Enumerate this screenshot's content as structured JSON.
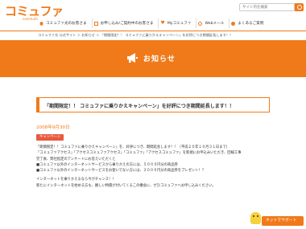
{
  "header": {
    "logo": "コミュファ",
    "logo_sub": "commufa",
    "search_placeholder": "サイト内を検索"
  },
  "nav": [
    {
      "label": "コミュファ光のお客さま",
      "icon": "home-icon"
    },
    {
      "label": "お申し込み/ご契約中のお客さま",
      "icon": "document-icon"
    },
    {
      "label": "Myコミュファ",
      "icon": "heart-icon"
    },
    {
      "label": "Webメール",
      "icon": "globe-icon"
    },
    {
      "label": "よくあるご質問",
      "icon": "question-icon"
    }
  ],
  "breadcrumb": "コミュファ光 公式サイト ＞ お知らせ ＞ 「期間限定！！ コミュファに乗りかえキャンペーン」を好評につき期間延長します！！",
  "banner": {
    "title": "お知らせ",
    "icon": "megaphone-icon",
    "color": "#f07a1a"
  },
  "notice": {
    "title": "「期間限定！！ コミュファに乗りかえキャンペーン」を好評につき期間延長します！！",
    "date": "2008年9月30日",
    "tag": "キャンペーン",
    "paragraphs": [
      "「期間限定！！コミュファに乗りかえキャンペーン」を、好評につき、期間延長します！！（平成２０年１０月３１日まで）",
      "「コミュファアクセス」「アクセスコミュファアクセス」「コミュファ」「アクセスコミュファ」を新規にお申込みいただき、回線工事",
      "完了後、弊社指定のアンケートにお答えいただくと",
      "■コミュファ以外のインターネットサービスから乗りかえの方には、５０００円分の商品券",
      "■コミュファ以外のインターネットサービスをお使いでない方には、３０００円分の商品券をプレゼント！？",
      "インターネットを乗りかえるなら今がチャンス！！",
      "新たにインターネットを始める方も、嬉しい特典が付いてくるこの機会に、ぜひコミュファへお申し込みください。"
    ]
  },
  "chat": {
    "label": "ネットでサポート",
    "icon": "mascot-icon"
  }
}
